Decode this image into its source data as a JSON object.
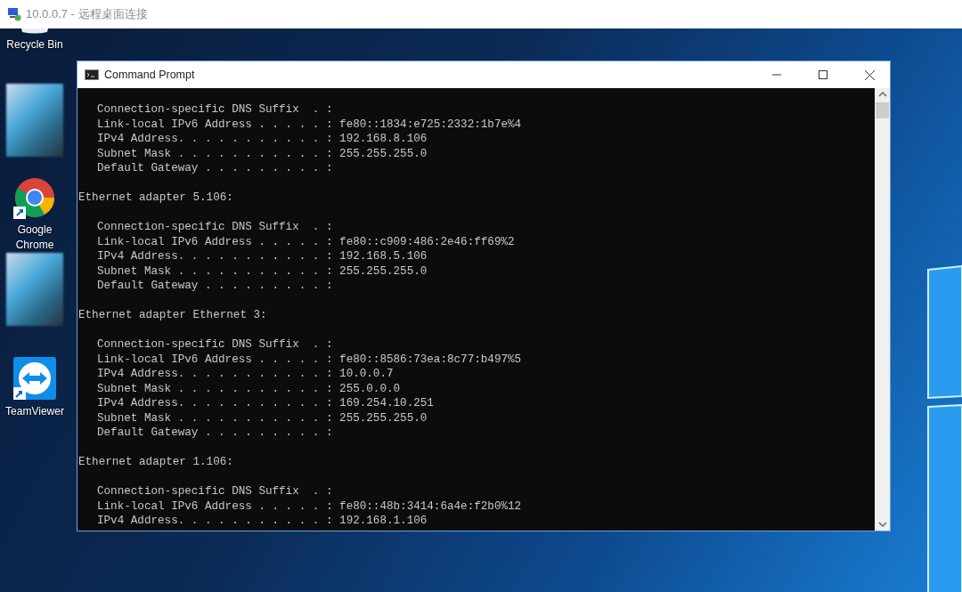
{
  "window": {
    "title": "10.0.0.7 - 远程桌面连接"
  },
  "desktop_icons": [
    {
      "kind": "recycle",
      "label": "Recycle Bin"
    },
    {
      "kind": "blurred"
    },
    {
      "kind": "chrome",
      "label": "Google Chrome"
    },
    {
      "kind": "blurred"
    },
    {
      "kind": "teamviewer",
      "label": "TeamViewer"
    }
  ],
  "console_window": {
    "title": "Command Prompt",
    "sections": [
      {
        "lines": [
          "Connection-specific DNS Suffix  . :",
          "Link-local IPv6 Address . . . . . : fe80::1834:e725:2332:1b7e%4",
          "IPv4 Address. . . . . . . . . . . : 192.168.8.106",
          "Subnet Mask . . . . . . . . . . . : 255.255.255.0",
          "Default Gateway . . . . . . . . . :"
        ]
      },
      {
        "heading": "Ethernet adapter 5.106:",
        "lines": [
          "Connection-specific DNS Suffix  . :",
          "Link-local IPv6 Address . . . . . : fe80::c909:486:2e46:ff69%2",
          "IPv4 Address. . . . . . . . . . . : 192.168.5.106",
          "Subnet Mask . . . . . . . . . . . : 255.255.255.0",
          "Default Gateway . . . . . . . . . :"
        ]
      },
      {
        "heading": "Ethernet adapter Ethernet 3:",
        "lines": [
          "Connection-specific DNS Suffix  . :",
          "Link-local IPv6 Address . . . . . : fe80::8586:73ea:8c77:b497%5",
          "IPv4 Address. . . . . . . . . . . : 10.0.0.7",
          "Subnet Mask . . . . . . . . . . . : 255.0.0.0",
          "IPv4 Address. . . . . . . . . . . : 169.254.10.251",
          "Subnet Mask . . . . . . . . . . . : 255.255.255.0",
          "Default Gateway . . . . . . . . . :"
        ]
      },
      {
        "heading": "Ethernet adapter 1.106:",
        "lines": [
          "Connection-specific DNS Suffix  . :",
          "Link-local IPv6 Address . . . . . : fe80::48b:3414:6a4e:f2b0%12",
          "IPv4 Address. . . . . . . . . . . : 192.168.1.106"
        ]
      }
    ]
  }
}
